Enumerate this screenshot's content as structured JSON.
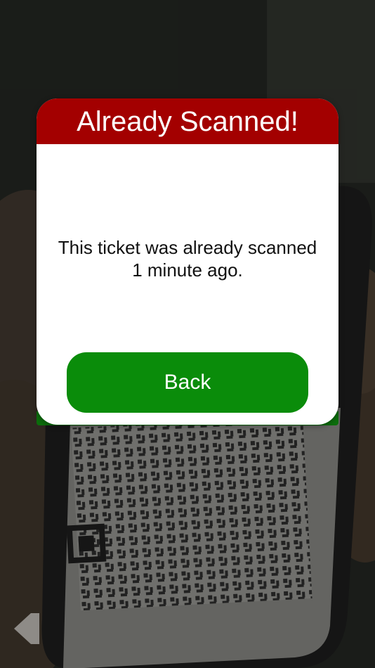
{
  "dialog": {
    "title": "Already Scanned!",
    "message": "This ticket was already scanned 1 minute ago.",
    "back_label": "Back"
  },
  "background": {
    "description_icon": "qr-code-camera-view"
  },
  "nav": {
    "back_icon": "back-arrow-icon"
  },
  "colors": {
    "header": "#a30000",
    "button": "#0a8c0a",
    "dialog_bg": "#ffffff",
    "text": "#111111"
  }
}
